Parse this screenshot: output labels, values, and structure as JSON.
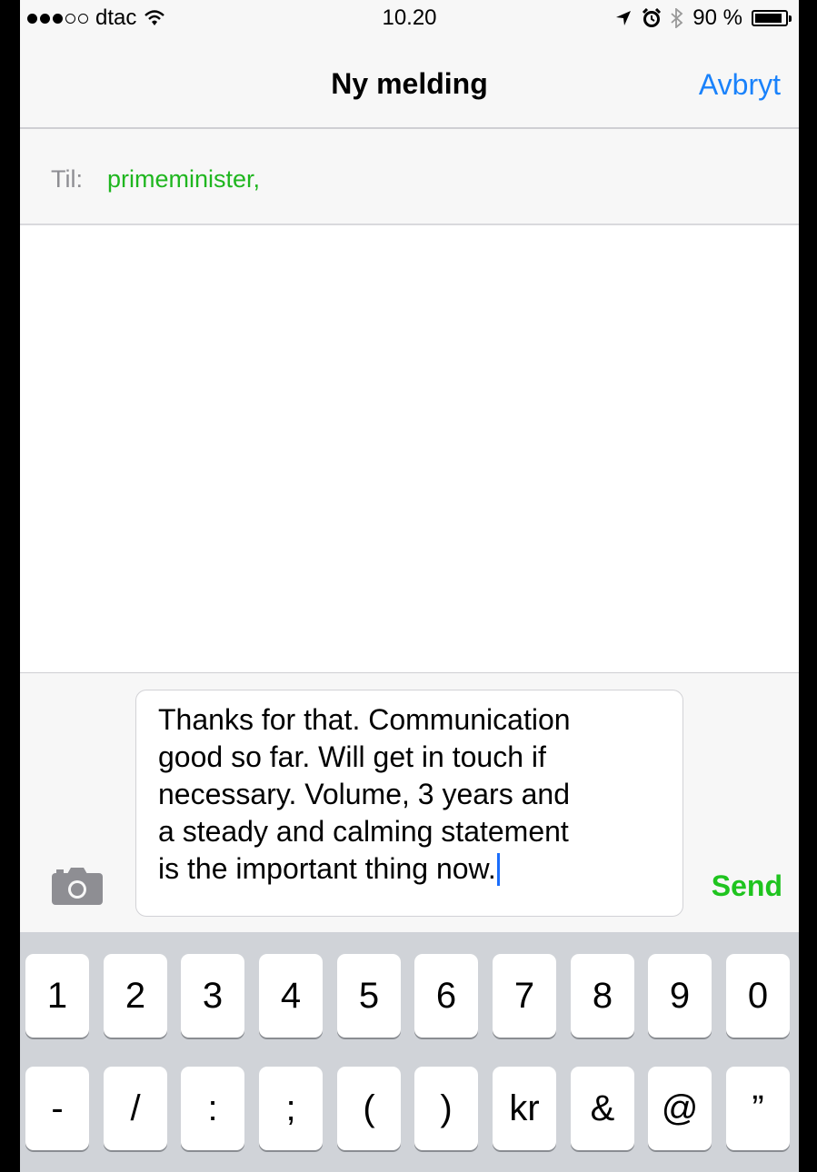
{
  "status_bar": {
    "carrier": "dtac",
    "time": "10.20",
    "battery": "90 %",
    "battery_level": 0.9
  },
  "nav": {
    "title": "Ny melding",
    "cancel_label": "Avbryt"
  },
  "recipients": {
    "label": "Til:",
    "recipient": "primeminister,"
  },
  "compose": {
    "message_text": "Thanks for that. Communication good so far. Will get in touch if necessary. Volume, 3 years and a steady and calming statement is the important thing now.",
    "message_lines": [
      "Thanks for that. Communication",
      "good so far. Will get in touch if",
      "necessary. Volume, 3 years and",
      "a steady and calming statement",
      "is the important thing now."
    ],
    "send_label": "Send"
  },
  "keyboard": {
    "row1": [
      "1",
      "2",
      "3",
      "4",
      "5",
      "6",
      "7",
      "8",
      "9",
      "0"
    ],
    "row2": [
      "-",
      "/",
      ":",
      ";",
      "(",
      ")",
      "kr",
      "&",
      "@",
      "”"
    ]
  },
  "colors": {
    "accent": "#1a82fb",
    "recipient": "#1fb61f",
    "send": "#1fc41f"
  }
}
